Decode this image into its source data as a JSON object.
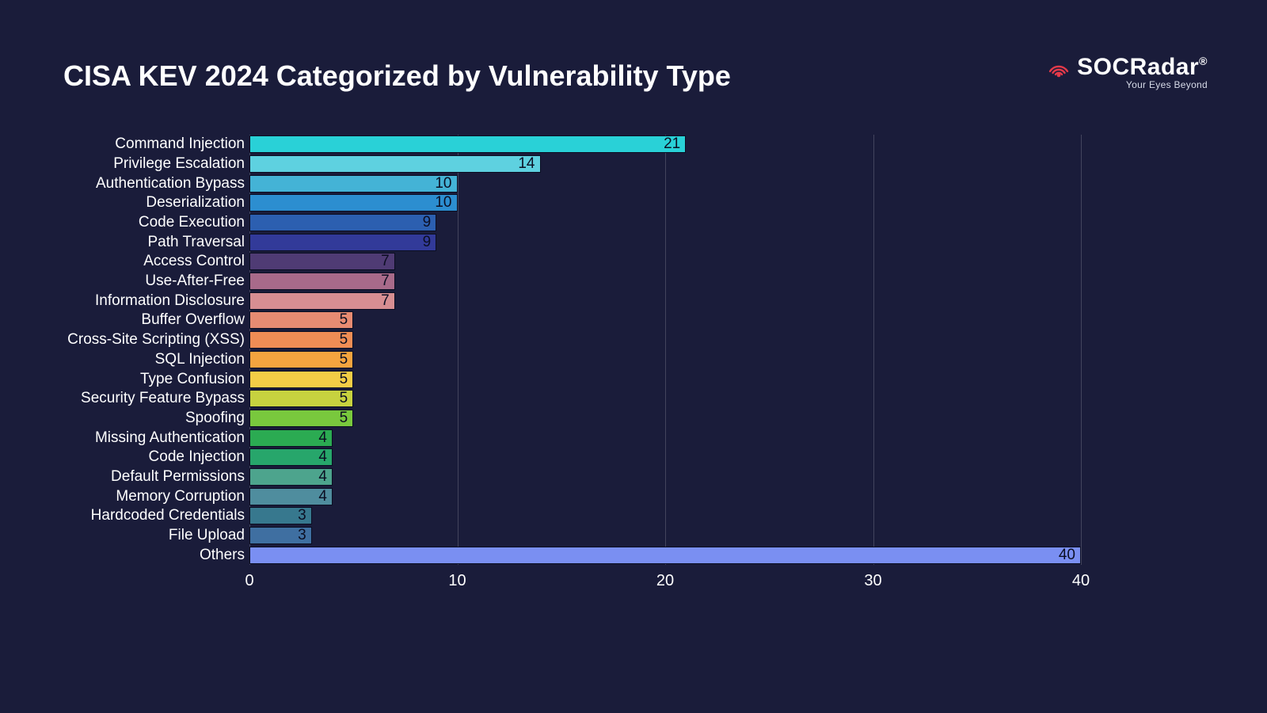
{
  "title": "CISA KEV 2024 Categorized by Vulnerability Type",
  "brand": {
    "name": "SOCRadar",
    "tagline": "Your Eyes Beyond",
    "mark": "®"
  },
  "chart_data": {
    "type": "bar",
    "orientation": "horizontal",
    "title": "CISA KEV 2024 Categorized by Vulnerability Type",
    "xlabel": "",
    "ylabel": "",
    "xlim": [
      0,
      40
    ],
    "xticks": [
      0,
      10,
      20,
      30,
      40
    ],
    "categories": [
      "Command Injection",
      "Privilege Escalation",
      "Authentication Bypass",
      "Deserialization",
      "Code Execution",
      "Path Traversal",
      "Access Control",
      "Use-After-Free",
      "Information Disclosure",
      "Buffer Overflow",
      "Cross-Site Scripting (XSS)",
      "SQL Injection",
      "Type Confusion",
      "Security Feature Bypass",
      "Spoofing",
      "Missing Authentication",
      "Code Injection",
      "Default Permissions",
      "Memory Corruption",
      "Hardcoded Credentials",
      "File Upload",
      "Others"
    ],
    "values": [
      21,
      14,
      10,
      10,
      9,
      9,
      7,
      7,
      7,
      5,
      5,
      5,
      5,
      5,
      5,
      4,
      4,
      4,
      4,
      3,
      3,
      40
    ],
    "colors": [
      "#29d1d7",
      "#5ed1e0",
      "#44b3d6",
      "#2c8ed0",
      "#2c5fb0",
      "#323a99",
      "#4f3b74",
      "#a86a8a",
      "#d78e92",
      "#e78b72",
      "#ef8d55",
      "#f4a43f",
      "#f3cd46",
      "#c7d23f",
      "#79c83d",
      "#2bab52",
      "#27a66b",
      "#4da48d",
      "#4f8d9e",
      "#37788e",
      "#3f6fa1",
      "#7a8ff2"
    ]
  }
}
